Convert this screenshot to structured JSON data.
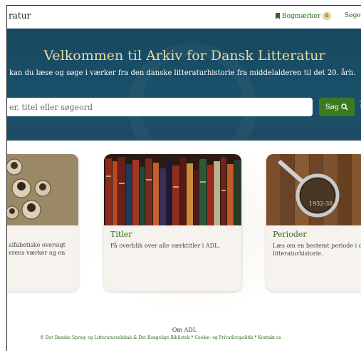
{
  "header": {
    "brand": "ratur",
    "bookmarks_label": "Bogmærker",
    "bookmarks_count": "0",
    "history_label": "Søgehist"
  },
  "hero": {
    "title": "Velkommen til Arkiv for Dansk Litteratur",
    "subtitle": "kan du læse og søge i værker fra den danske litteraturhistorie fra middelalderen til det 20. årh.",
    "search_placeholder": "er, titel eller søgeord",
    "search_button": "Søg",
    "help": "?"
  },
  "cards": [
    {
      "title": "",
      "desc_line1": "alfabetiske oversigt",
      "desc_line2": "erens værker og en"
    },
    {
      "title": "Titler",
      "desc": "Få overblik over alle værktitler i ADL."
    },
    {
      "title": "Perioder",
      "desc_line1": "Læs om en bestemt periode i de",
      "desc_line2": "litteraturhistorie."
    }
  ],
  "periods_card": {
    "book_label": "1932-38"
  },
  "footer": {
    "title": "Om ADL",
    "copyright": "©",
    "link1": "Det Danske Sprog- og Litteraturselskab",
    "amp": "&",
    "link2": "Det Kongelige Bibliotek",
    "sep1": "*",
    "link3": "Cookie- og Privatlivspolitik",
    "sep2": "*",
    "link4": "Kontakt os"
  },
  "colors": {
    "accent_green": "#3c7a21",
    "hero_blue": "#1a506a",
    "title_gold": "#e9d9a3"
  }
}
